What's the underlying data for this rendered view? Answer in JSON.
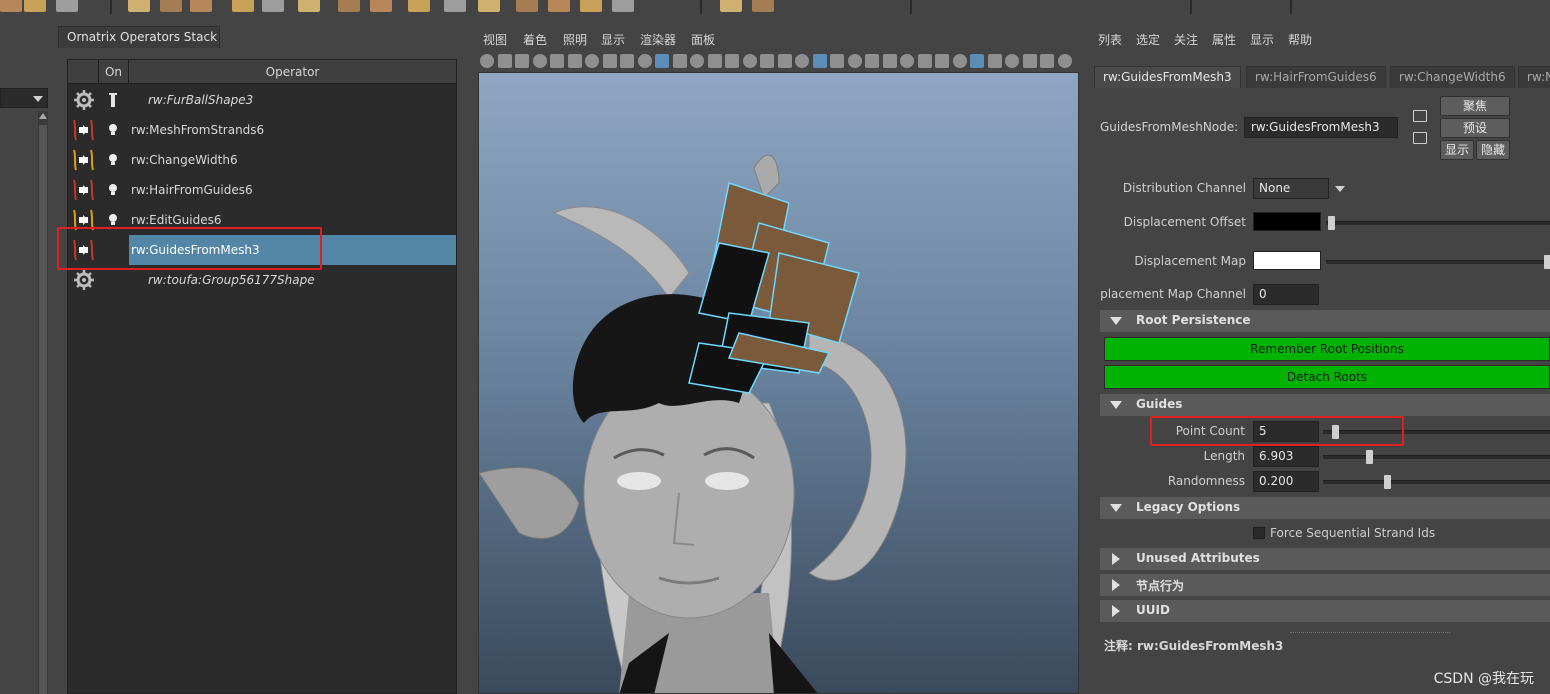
{
  "shelf": {
    "icons": [
      "shelf-tool-icon",
      "shelf-tool-icon",
      "shelf-tool-icon",
      "shelf-tool-icon",
      "shelf-tool-icon",
      "shelf-tool-icon",
      "shelf-tool-icon",
      "shelf-tool-icon",
      "shelf-tool-icon",
      "shelf-tool-icon",
      "shelf-tool-icon",
      "shelf-tool-icon",
      "shelf-tool-icon",
      "shelf-tool-icon",
      "shelf-tool-icon",
      "shelf-tool-icon",
      "shelf-tool-icon",
      "shelf-tool-icon",
      "shelf-tool-icon",
      "shelf-tool-icon"
    ]
  },
  "operators_panel": {
    "tab_title": "Ornatrix Operators Stack",
    "column_on": "On",
    "column_operator": "Operator",
    "rows": [
      {
        "name": "rw:FurBallShape3",
        "icon": "gear-icon",
        "italic": true,
        "on_icon": "bar-icon",
        "selected": false
      },
      {
        "name": "rw:MeshFromStrands6",
        "icon": "mesh-from-strands-icon",
        "italic": false,
        "on_icon": "bulb-icon",
        "selected": false
      },
      {
        "name": "rw:ChangeWidth6",
        "icon": "change-width-icon",
        "italic": false,
        "on_icon": "bulb-icon",
        "selected": false
      },
      {
        "name": "rw:HairFromGuides6",
        "icon": "hair-from-guides-icon",
        "italic": false,
        "on_icon": "bulb-icon",
        "selected": false
      },
      {
        "name": "rw:EditGuides6",
        "icon": "edit-guides-icon",
        "italic": false,
        "on_icon": "bulb-icon",
        "selected": false
      },
      {
        "name": "rw:GuidesFromMesh3",
        "icon": "guides-from-mesh-icon",
        "italic": false,
        "on_icon": "",
        "selected": true
      },
      {
        "name": "rw:toufa:Group56177Shape",
        "icon": "gear-icon",
        "italic": true,
        "on_icon": "",
        "selected": false
      }
    ]
  },
  "viewport": {
    "menu": [
      "视图",
      "着色",
      "照明",
      "显示",
      "渲染器",
      "面板"
    ]
  },
  "attribute_editor": {
    "menu": [
      "列表",
      "选定",
      "关注",
      "属性",
      "显示",
      "帮助"
    ],
    "tabs": [
      "rw:GuidesFromMesh3",
      "rw:HairFromGuides6",
      "rw:ChangeWidth6",
      "rw:N"
    ],
    "node_label": "GuidesFromMeshNode:",
    "node_value": "rw:GuidesFromMesh3",
    "buttons": {
      "focus": "聚焦",
      "presets": "预设",
      "show": "显示",
      "hide": "隐藏"
    },
    "distribution_channel": {
      "label": "Distribution Channel",
      "value": "None"
    },
    "displacement_offset": {
      "label": "Displacement Offset",
      "color": "#000000"
    },
    "displacement_map": {
      "label": "Displacement Map",
      "color": "#ffffff"
    },
    "displacement_map_channel": {
      "label": "Displacement Map Channel",
      "value": "0"
    },
    "sections": {
      "root_persistence": "Root Persistence",
      "guides": "Guides",
      "legacy_options": "Legacy Options",
      "unused_attributes": "Unused Attributes",
      "node_behavior": "节点行为",
      "uuid": "UUID"
    },
    "green_buttons": {
      "remember": "Remember Root Positions",
      "detach": "Detach Roots"
    },
    "guides": {
      "point_count": {
        "label": "Point Count",
        "value": "5",
        "slider": 0.04
      },
      "length": {
        "label": "Length",
        "value": "6.903",
        "slider": 0.19
      },
      "randomness": {
        "label": "Randomness",
        "value": "0.200",
        "slider": 0.27
      }
    },
    "legacy": {
      "force_sequential_label": "Force Sequential Strand Ids"
    },
    "note": "注释:  rw:GuidesFromMesh3",
    "accent_green": "#00b300",
    "highlight_red": "#e02020"
  },
  "watermark": "CSDN @我在玩"
}
